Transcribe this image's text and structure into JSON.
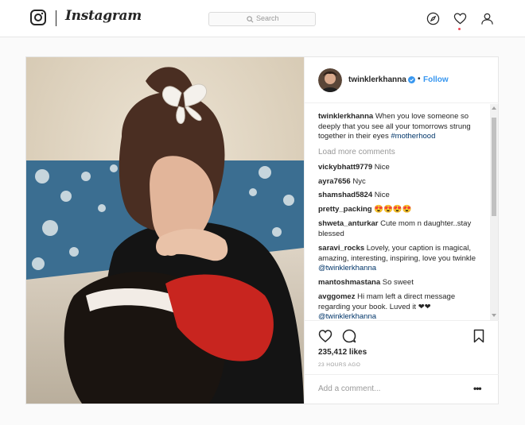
{
  "app": {
    "wordmark": "Instagram"
  },
  "search": {
    "placeholder": "Search"
  },
  "nav": {
    "icons": [
      "compass-icon",
      "heart-icon",
      "profile-icon"
    ]
  },
  "post": {
    "author": "twinklerkhanna",
    "follow_label": "Follow",
    "dot": "•",
    "caption": {
      "user": "twinklerkhanna",
      "text": "When you love someone so deeply that you see all your tomorrows strung together in their eyes",
      "hashtag": "#motherhood"
    },
    "load_more": "Load more comments",
    "comments": [
      {
        "user": "vickybhatt9779",
        "text": "Nice"
      },
      {
        "user": "ayra7656",
        "text": "Nyc"
      },
      {
        "user": "shamshad5824",
        "text": "Nice"
      },
      {
        "user": "pretty_packing",
        "text": "😍😍😍😍"
      },
      {
        "user": "shweta_anturkar",
        "text": "Cute mom n daughter..stay blessed"
      },
      {
        "user": "saravi_rocks",
        "text": "Lovely, your caption is magical, amazing, interesting, inspiring, love you twinkle",
        "mention": "@twinklerkhanna"
      },
      {
        "user": "mantoshmastana",
        "text": "So sweet"
      },
      {
        "user": "avggomez",
        "text": "Hi mam left a direct message regarding your book. Luved it ❤❤",
        "mention": "@twinklerkhanna"
      }
    ],
    "likes": "235,412 likes",
    "time": "23 HOURS AGO",
    "add_comment_placeholder": "Add a comment...",
    "more_label": "•••"
  },
  "colors": {
    "link": "#3897f0",
    "tag": "#003569",
    "notif": "#ed4956"
  }
}
